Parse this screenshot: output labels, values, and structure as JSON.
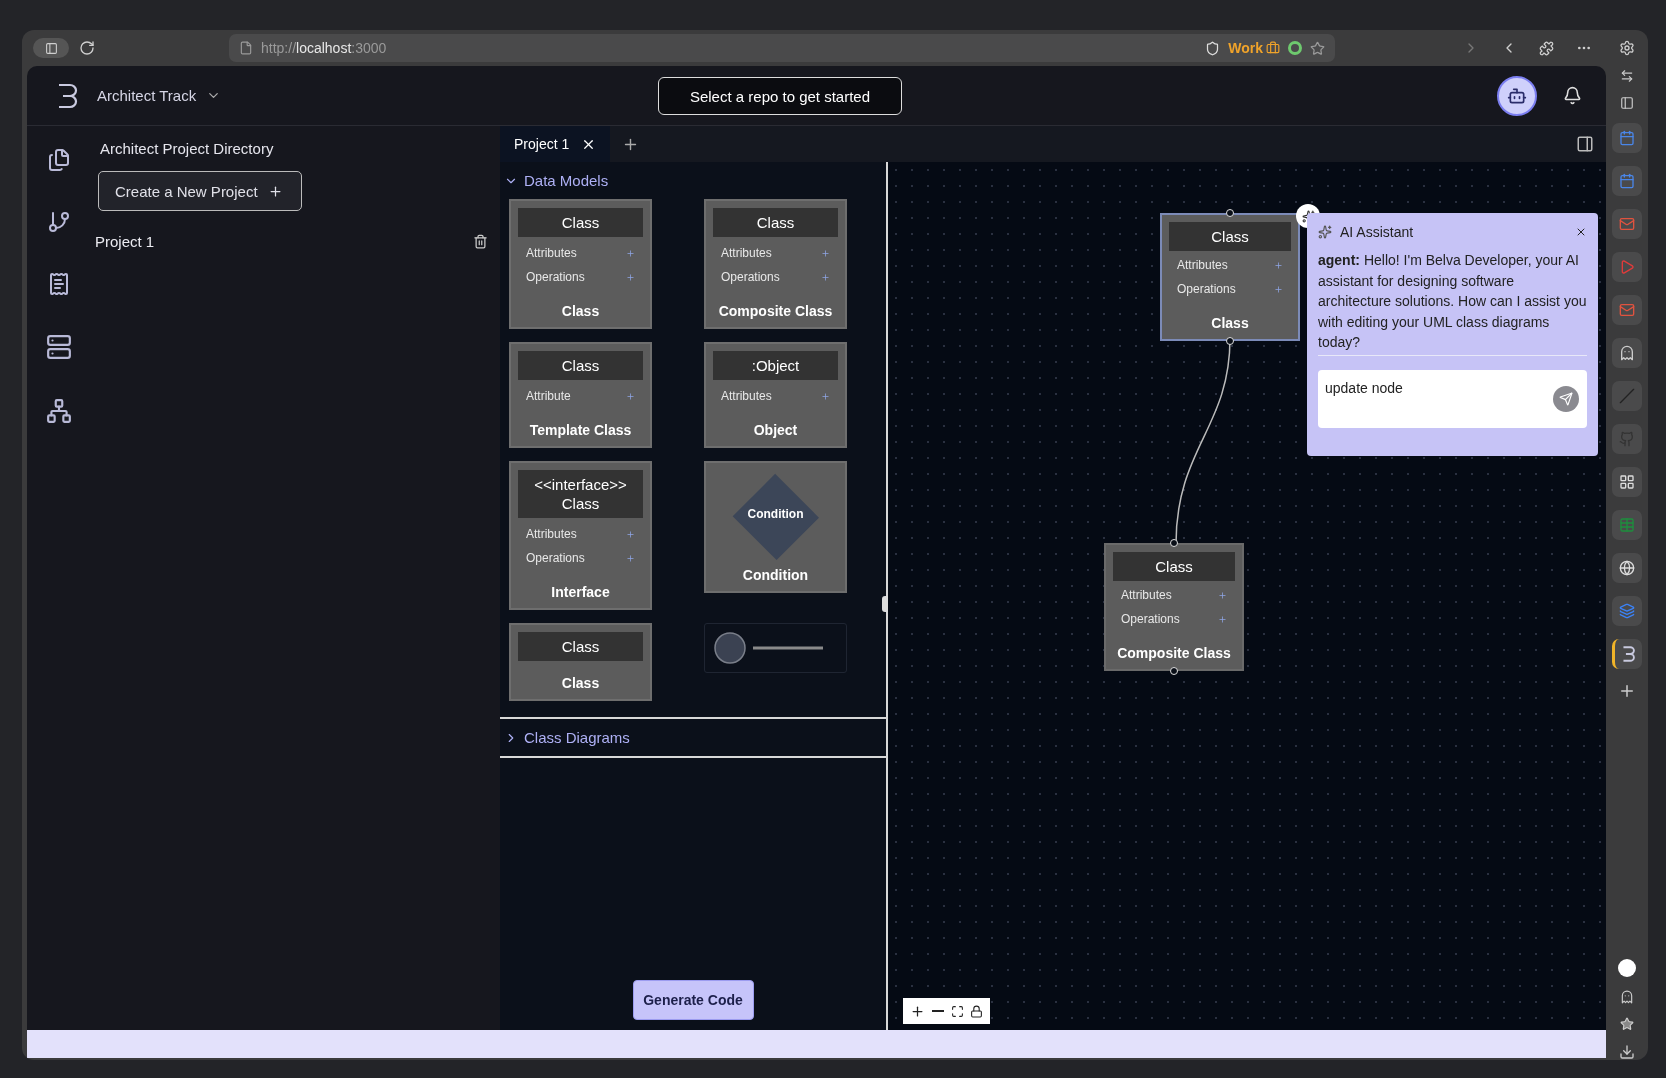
{
  "browser": {
    "url": "http://**localhost**:3000",
    "profile": "Work"
  },
  "header": {
    "app_title": "Architect Track",
    "repo_button": "Select a repo to get started"
  },
  "project_directory": {
    "title": "Architect Project Directory",
    "create_button": "Create a New Project",
    "projects": [
      {
        "name": "Project 1"
      }
    ]
  },
  "tabs": [
    {
      "label": "Project 1",
      "selected": true
    }
  ],
  "palette": {
    "sections": [
      {
        "title": "Data Models",
        "expanded": true,
        "items": [
          {
            "kind": "class",
            "header": [
              "Class"
            ],
            "rows": [
              "Attributes",
              "Operations"
            ],
            "label": "Class"
          },
          {
            "kind": "class",
            "header": [
              "Class"
            ],
            "rows": [
              "Attributes",
              "Operations"
            ],
            "label": "Composite Class"
          },
          {
            "kind": "class",
            "header": [
              "Class"
            ],
            "rows": [
              "Attribute"
            ],
            "label": "Template Class"
          },
          {
            "kind": "class",
            "header": [
              ":Object"
            ],
            "rows": [
              "Attributes"
            ],
            "label": "Object"
          },
          {
            "kind": "class",
            "header": [
              "<<interface>>",
              "Class"
            ],
            "rows": [
              "Attributes",
              "Operations"
            ],
            "label": "Interface"
          },
          {
            "kind": "condition",
            "shape_text": "Condition",
            "label": "Condition"
          },
          {
            "kind": "class",
            "header": [
              "Class"
            ],
            "label": "Class"
          },
          {
            "kind": "edge"
          }
        ]
      },
      {
        "title": "Class Diagrams",
        "expanded": false
      }
    ],
    "generate_button": "Generate Code"
  },
  "canvas": {
    "nodes": [
      {
        "header": "Class",
        "rows": [
          "Attributes",
          "Operations"
        ],
        "label": "Class",
        "selected": true
      },
      {
        "header": "Class",
        "rows": [
          "Attributes",
          "Operations"
        ],
        "label": "Composite Class",
        "selected": false
      }
    ],
    "assistant": {
      "title": "AI Assistant",
      "message": "**agent:** Hello! I'm Belva Developer, your AI assistant for designing software architecture solutions. How can I assist you with editing your UML class diagrams today?",
      "input_value": "update node"
    }
  }
}
